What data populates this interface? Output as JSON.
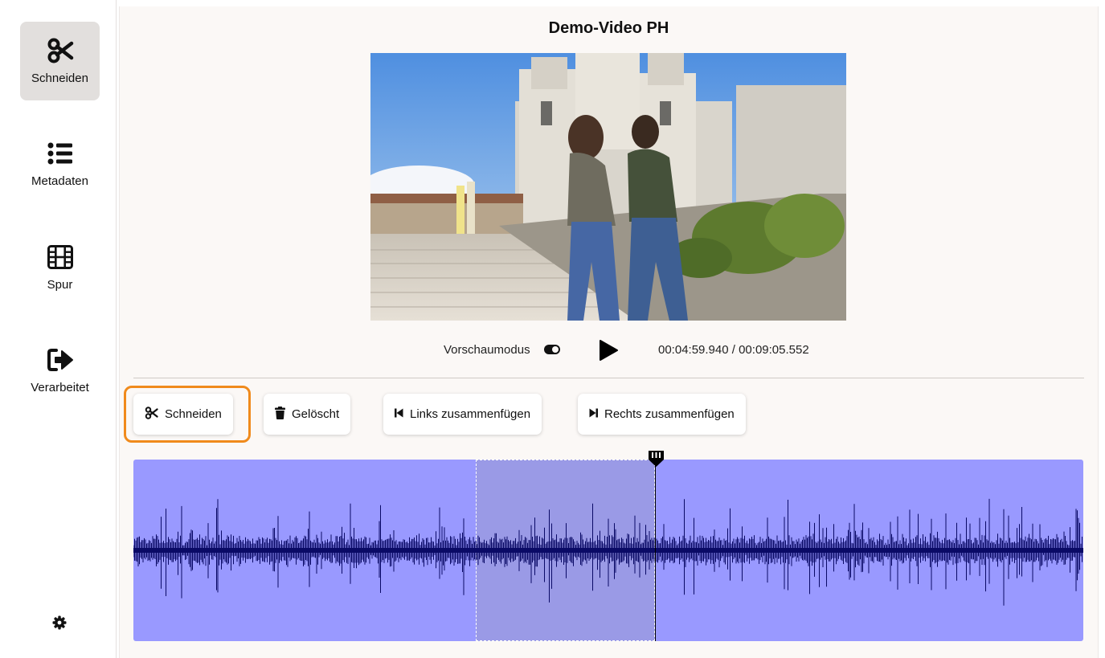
{
  "sidebar": {
    "items": [
      {
        "label": "Schneiden",
        "icon": "scissors-icon",
        "active": true
      },
      {
        "label": "Metadaten",
        "icon": "list-icon",
        "active": false
      },
      {
        "label": "Spur",
        "icon": "film-icon",
        "active": false
      },
      {
        "label": "Verarbeitet",
        "icon": "sign-out-icon",
        "active": false
      }
    ],
    "settings_icon": "gear-icon"
  },
  "main": {
    "title": "Demo-Video PH",
    "preview_mode_label": "Vorschaumodus",
    "time_display": "00:04:59.940 / 00:09:05.552"
  },
  "toolbar": {
    "cut_label": "Schneiden",
    "deleted_label": "Gelöscht",
    "merge_left_label": "Links zusammenfügen",
    "merge_right_label": "Rechts zusammenfügen"
  },
  "timeline": {
    "current_time": "00:04:59.940",
    "duration": "00:09:05.552",
    "track_color": "#9999ff",
    "selected_segment_color": "#9a9ae6",
    "waveform_color": "#0a0a66"
  },
  "colors": {
    "focus_outline": "#f08a1c",
    "active_nav": "#e2dfdd"
  }
}
